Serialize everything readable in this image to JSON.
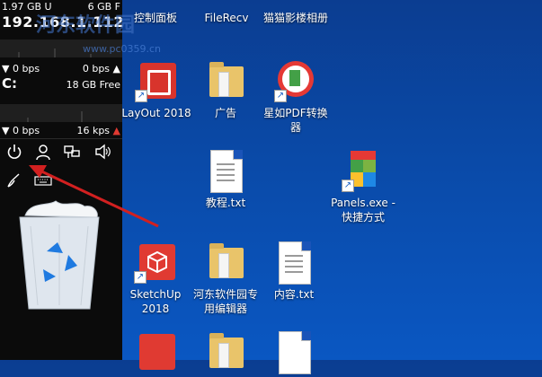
{
  "monitor": {
    "mem_used": "1.97 GB U",
    "mem_free": "6 GB F",
    "ip": "192.168.1.112",
    "net1_down": "▼ 0 bps",
    "net1_up": "0 bps ▲",
    "drive_label": "C:",
    "drive_free": "18 GB Free",
    "net2_down": "▼ 0 bps",
    "net2_up": "16 kps",
    "net2_up_marker": "▲"
  },
  "watermark": {
    "brand": "河东软件园",
    "url": "www.pc0359.cn"
  },
  "desktop_icons": [
    {
      "label": "控制面板"
    },
    {
      "label": "FileRecv"
    },
    {
      "label": "猫猫影楼相册"
    },
    {
      "label": "LayOut 2018"
    },
    {
      "label": "广告"
    },
    {
      "label": "星如PDF转换器"
    },
    {
      "label": "教程.txt"
    },
    {
      "label": "Panels.exe - 快捷方式"
    },
    {
      "label": "SketchUp 2018"
    },
    {
      "label": "河东软件园专用编辑器"
    },
    {
      "label": "内容.txt"
    }
  ],
  "shortcut_glyph": "↗",
  "colors": {
    "desktop": "#0a4aa8",
    "panel": "#0b0b0b",
    "arrow": "#d22020"
  }
}
